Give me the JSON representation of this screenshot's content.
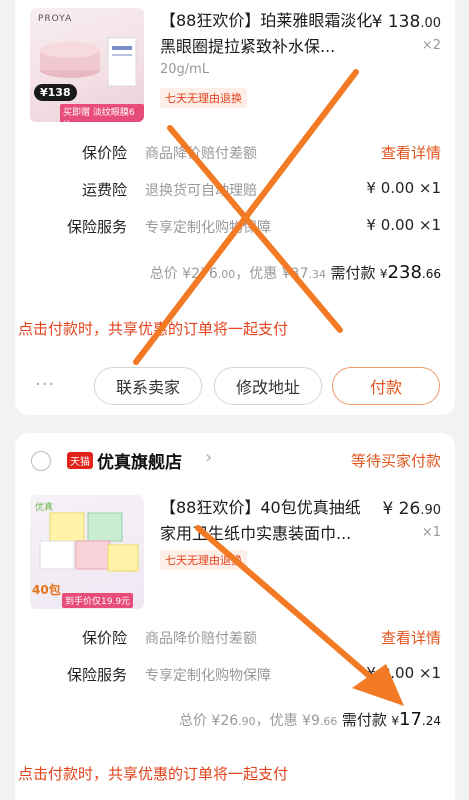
{
  "order1": {
    "product": {
      "title": "【88狂欢价】珀莱雅眼霜淡化黑眼圈提拉紧致补水保...",
      "price_sym": "¥",
      "price_int": "138",
      "price_dec": ".00",
      "qty": "×2",
      "spec": "20g/mL",
      "tag": "七天无理由退换",
      "image_brand": "PROYA",
      "image_price": "138",
      "image_caption": "买即赠 淡纹眼膜6片"
    },
    "services": [
      {
        "label": "保价险",
        "value": "商品降价赔付差额",
        "right": "查看详情"
      },
      {
        "label": "运费险",
        "value": "退换货可自动理赔",
        "right": "¥ 0.00 ×1"
      },
      {
        "label": "保险服务",
        "value": "专享定制化购物保障",
        "right": "¥ 0.00 ×1"
      }
    ],
    "total": {
      "prefix": "总价 ¥",
      "total_int": "276",
      "total_dec": ".00",
      "disc_label": "，优惠 ¥",
      "disc_int": "37",
      "disc_dec": ".34",
      "pay_label": "需付款",
      "pay_sym": "¥",
      "pay_int": "238",
      "pay_dec": ".66"
    },
    "notice": "点击付款时，共享优惠的订单将一起支付",
    "more": "···",
    "buttons": {
      "contact": "联系卖家",
      "address": "修改地址",
      "pay": "付款"
    }
  },
  "order2": {
    "shop_badge": "天猫",
    "shop_name": "优真旗舰店",
    "status": "等待买家付款",
    "product": {
      "title": "【88狂欢价】40包优真抽纸家用卫生纸巾实惠装面巾...",
      "price_sym": "¥",
      "price_int": "26",
      "price_dec": ".90",
      "qty": "×1",
      "tag": "七天无理由退换",
      "image_brand": "优真",
      "image_count": "40包",
      "image_caption": "到手价仅19.9元"
    },
    "services": [
      {
        "label": "保价险",
        "value": "商品降价赔付差额",
        "right": "查看详情"
      },
      {
        "label": "保险服务",
        "value": "专享定制化购物保障",
        "right": "¥ 0.00 ×1"
      }
    ],
    "total": {
      "prefix": "总价 ¥",
      "total_int": "26",
      "total_dec": ".90",
      "disc_label": "，优惠 ¥",
      "disc_int": "9",
      "disc_dec": ".66",
      "pay_label": "需付款",
      "pay_sym": "¥",
      "pay_int": "17",
      "pay_dec": ".24"
    },
    "notice": "点击付款时，共享优惠的订单将一起支付"
  },
  "colors": {
    "accent": "#e2541e",
    "red": "#e2431c",
    "annotation": "#f27a24",
    "bg": "#f2f2f2"
  }
}
